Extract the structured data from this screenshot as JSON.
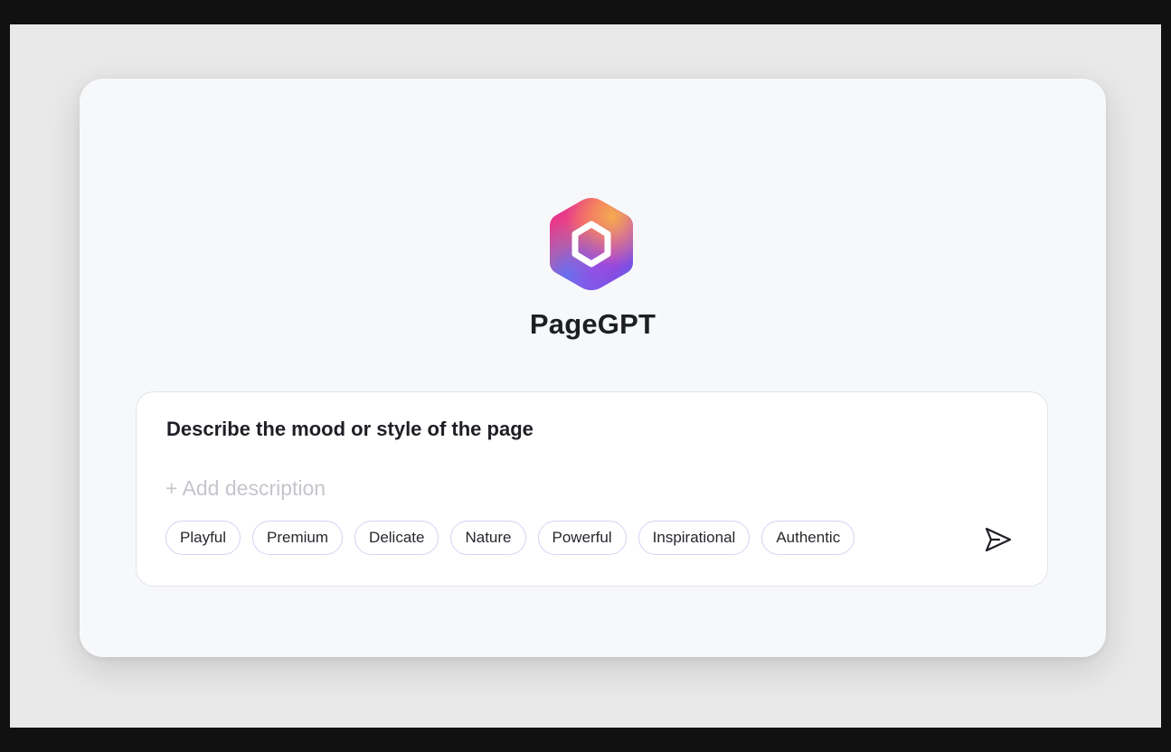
{
  "app": {
    "title": "PageGPT"
  },
  "prompt": {
    "heading": "Describe the mood or style of the page",
    "placeholder": "+ Add description",
    "tags": [
      "Playful",
      "Premium",
      "Delicate",
      "Nature",
      "Powerful",
      "Inspirational",
      "Authentic"
    ]
  },
  "icons": {
    "logo": "hexagon-logo-icon",
    "send": "send-icon"
  },
  "colors": {
    "tag_border": "#d8d2f4",
    "logo_gradient": [
      "#f2a24c",
      "#e8307a",
      "#b53ad6",
      "#5a6ef2"
    ]
  }
}
